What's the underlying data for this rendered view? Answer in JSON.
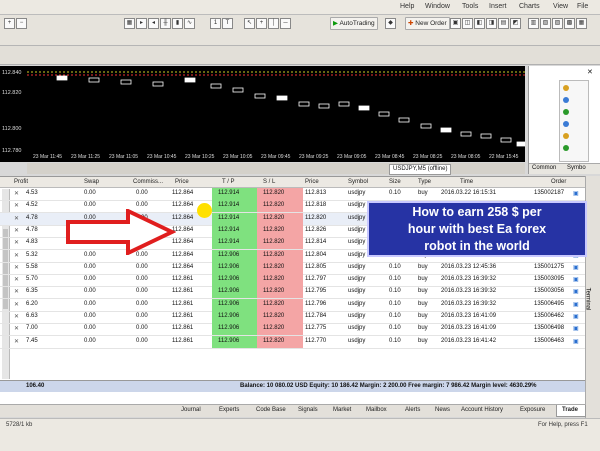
{
  "colors": {
    "accent": "#2633a4",
    "sl_bg": "#f4a5a5",
    "tp_bg": "#7fe17f",
    "arrow": "#e01e1e"
  },
  "menu": [
    "Help",
    "Window",
    "Tools",
    "Insert",
    "Charts",
    "View",
    "File"
  ],
  "toolbar": {
    "autotrading": "AutoTrading",
    "neworder": "New Order"
  },
  "chart": {
    "tab_label": "USDJPY,M5 (offline)",
    "price_labels": [
      "112.840",
      "112.820",
      "112.800",
      "112.780"
    ],
    "time_labels": [
      "23 Mar 11:45",
      "23 Mar 11:25",
      "23 Mar 11:05",
      "23 Mar 10:45",
      "23 Mar 10:25",
      "23 Mar 10:05",
      "23 Mar 09:45",
      "23 Mar 09:25",
      "23 Mar 09:05",
      "23 Mar 08:45",
      "23 Mar 08:25",
      "23 Mar 08:05",
      "22 Mar 15:45"
    ]
  },
  "navigator": {
    "tabs": [
      "Common",
      "Symbo"
    ]
  },
  "terminal": {
    "headers": {
      "order": "Order",
      "time": "Time",
      "type": "Type",
      "size": "Size",
      "symbol": "Symbol",
      "price": "Price",
      "sl": "S / L",
      "tp": "T / P",
      "price2": "Price",
      "commission": "Commiss...",
      "swap": "Swap",
      "profit": "Profit"
    },
    "rows": [
      {
        "order": "135002187",
        "time": "2016.03.22 16:15:31",
        "type": "buy",
        "size": "0.10",
        "symbol": "usdjpy",
        "price": "112.813",
        "sl": "112.820",
        "tp": "112.914",
        "price2": "112.864",
        "commission": "0.00",
        "swap": "0.00",
        "profit": "4.53"
      },
      {
        "order": "135002188",
        "time": "2016.03.22 16:15:34",
        "type": "buy",
        "size": "0.10",
        "symbol": "usdjpy",
        "price": "112.818",
        "sl": "112.820",
        "tp": "112.914",
        "price2": "112.864",
        "commission": "0.00",
        "swap": "0.00",
        "profit": "4.52"
      },
      {
        "order": "135002189",
        "time": "2016.03.22 16:15:36",
        "type": "buy",
        "size": "0.10",
        "symbol": "usdjpy",
        "price": "112.820",
        "sl": "112.820",
        "tp": "112.914",
        "price2": "112.864",
        "commission": "0.00",
        "swap": "0.00",
        "profit": "4.78"
      },
      {
        "order": "135002190",
        "time": "2016.03.22 16:16:12",
        "type": "buy",
        "size": "0.10",
        "symbol": "usdjpy",
        "price": "112.826",
        "sl": "112.820",
        "tp": "112.914",
        "price2": "112.864",
        "commission": "0.00",
        "swap": "0.00",
        "profit": "4.78"
      },
      {
        "order": "135003106",
        "time": "2016.03.23 12:24:18",
        "type": "buy",
        "size": "0.10",
        "symbol": "usdjpy",
        "price": "112.814",
        "sl": "112.820",
        "tp": "112.914",
        "price2": "112.864",
        "commission": "0.00",
        "swap": "0.00",
        "profit": "4.83"
      },
      {
        "order": "135003107",
        "time": "2016.03.23 12:37:21",
        "type": "buy",
        "size": "0.10",
        "symbol": "usdjpy",
        "price": "112.804",
        "sl": "112.820",
        "tp": "112.906",
        "price2": "112.864",
        "commission": "0.00",
        "swap": "0.00",
        "profit": "5.32"
      },
      {
        "order": "135001275",
        "time": "2016.03.23 12:45:36",
        "type": "buy",
        "size": "0.10",
        "symbol": "usdjpy",
        "price": "112.805",
        "sl": "112.820",
        "tp": "112.906",
        "price2": "112.864",
        "commission": "0.00",
        "swap": "0.00",
        "profit": "5.58"
      },
      {
        "order": "135003095",
        "time": "2016.03.23 16:39:32",
        "type": "buy",
        "size": "0.10",
        "symbol": "usdjpy",
        "price": "112.797",
        "sl": "112.820",
        "tp": "112.906",
        "price2": "112.861",
        "commission": "0.00",
        "swap": "0.00",
        "profit": "5.70"
      },
      {
        "order": "135003056",
        "time": "2016.03.23 16:39:32",
        "type": "buy",
        "size": "0.10",
        "symbol": "usdjpy",
        "price": "112.795",
        "sl": "112.820",
        "tp": "112.906",
        "price2": "112.861",
        "commission": "0.00",
        "swap": "0.00",
        "profit": "6.35"
      },
      {
        "order": "135006495",
        "time": "2016.03.23 16:39:32",
        "type": "buy",
        "size": "0.10",
        "symbol": "usdjpy",
        "price": "112.796",
        "sl": "112.820",
        "tp": "112.906",
        "price2": "112.861",
        "commission": "0.00",
        "swap": "0.00",
        "profit": "6.20"
      },
      {
        "order": "135006462",
        "time": "2016.03.23 16:41:09",
        "type": "buy",
        "size": "0.10",
        "symbol": "usdjpy",
        "price": "112.784",
        "sl": "112.820",
        "tp": "112.906",
        "price2": "112.861",
        "commission": "0.00",
        "swap": "0.00",
        "profit": "6.63"
      },
      {
        "order": "135006498",
        "time": "2016.03.23 16:41:09",
        "type": "buy",
        "size": "0.10",
        "symbol": "usdjpy",
        "price": "112.775",
        "sl": "112.820",
        "tp": "112.906",
        "price2": "112.861",
        "commission": "0.00",
        "swap": "0.00",
        "profit": "7.00"
      },
      {
        "order": "135006463",
        "time": "2016.03.23 16:41:42",
        "type": "buy",
        "size": "0.10",
        "symbol": "usdjpy",
        "price": "112.770",
        "sl": "112.820",
        "tp": "112.906",
        "price2": "112.861",
        "commission": "0.00",
        "swap": "0.00",
        "profit": "7.45"
      }
    ],
    "balance": "Balance: 10 080.02 USD  Equity: 10 186.42  Margin: 2 200.00  Free margin: 7 986.42  Margin level: 4630.29%",
    "total_profit": "106.40",
    "tabs": [
      "Trade",
      "Exposure",
      "Account History",
      "News",
      "Alerts",
      "Mailbox",
      "Market",
      "Signals",
      "Code Base",
      "Experts",
      "Journal"
    ],
    "side_label": "Terminal"
  },
  "overlay": {
    "line1": "How to earn 258 $ per",
    "line2": "hour with best Ea forex",
    "line3": "robot in the world"
  },
  "status": {
    "help": "For Help, press F1",
    "traffic": "5728/1 kb"
  }
}
